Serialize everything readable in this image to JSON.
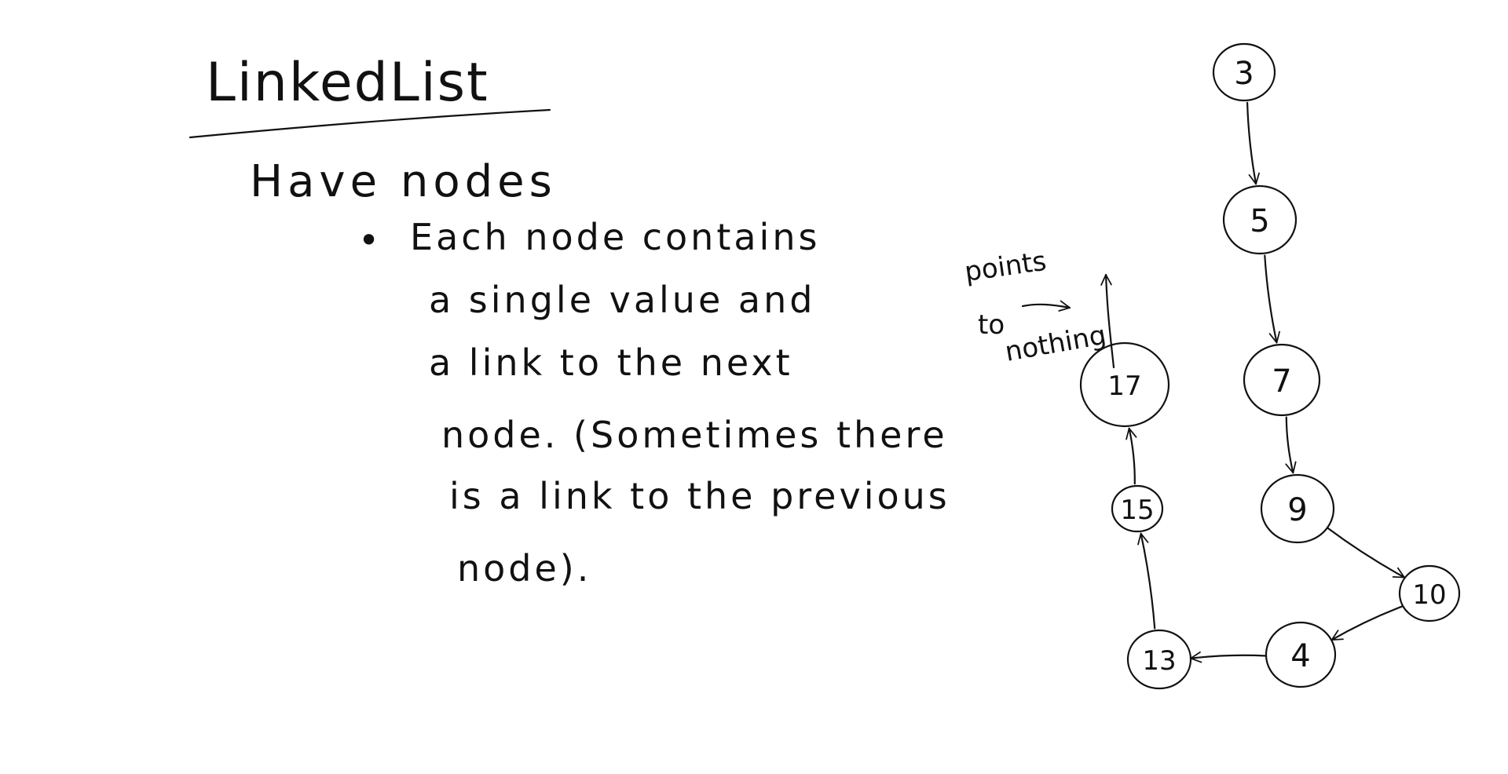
{
  "notes": {
    "title": "LinkedList",
    "heading": "Have nodes",
    "bullet": "•",
    "lines": [
      "Each node contains",
      "a single value and",
      "a link to the next",
      "node. (Sometimes there",
      "is a link to the previous",
      "node)."
    ]
  },
  "annotation": {
    "word1": "points",
    "word2": "to",
    "word3": "nothing"
  },
  "nodes": [
    {
      "id": "n3",
      "value": "3"
    },
    {
      "id": "n5",
      "value": "5"
    },
    {
      "id": "n7",
      "value": "7"
    },
    {
      "id": "n9",
      "value": "9"
    },
    {
      "id": "n10",
      "value": "10"
    },
    {
      "id": "n4",
      "value": "4"
    },
    {
      "id": "n13",
      "value": "13"
    },
    {
      "id": "n15",
      "value": "15"
    },
    {
      "id": "n17",
      "value": "17"
    }
  ],
  "links": [
    {
      "from": "n3",
      "to": "n5"
    },
    {
      "from": "n5",
      "to": "n7"
    },
    {
      "from": "n7",
      "to": "n9"
    },
    {
      "from": "n9",
      "to": "n10"
    },
    {
      "from": "n10",
      "to": "n4"
    },
    {
      "from": "n4",
      "to": "n13"
    },
    {
      "from": "n13",
      "to": "n15"
    },
    {
      "from": "n15",
      "to": "n17"
    }
  ]
}
